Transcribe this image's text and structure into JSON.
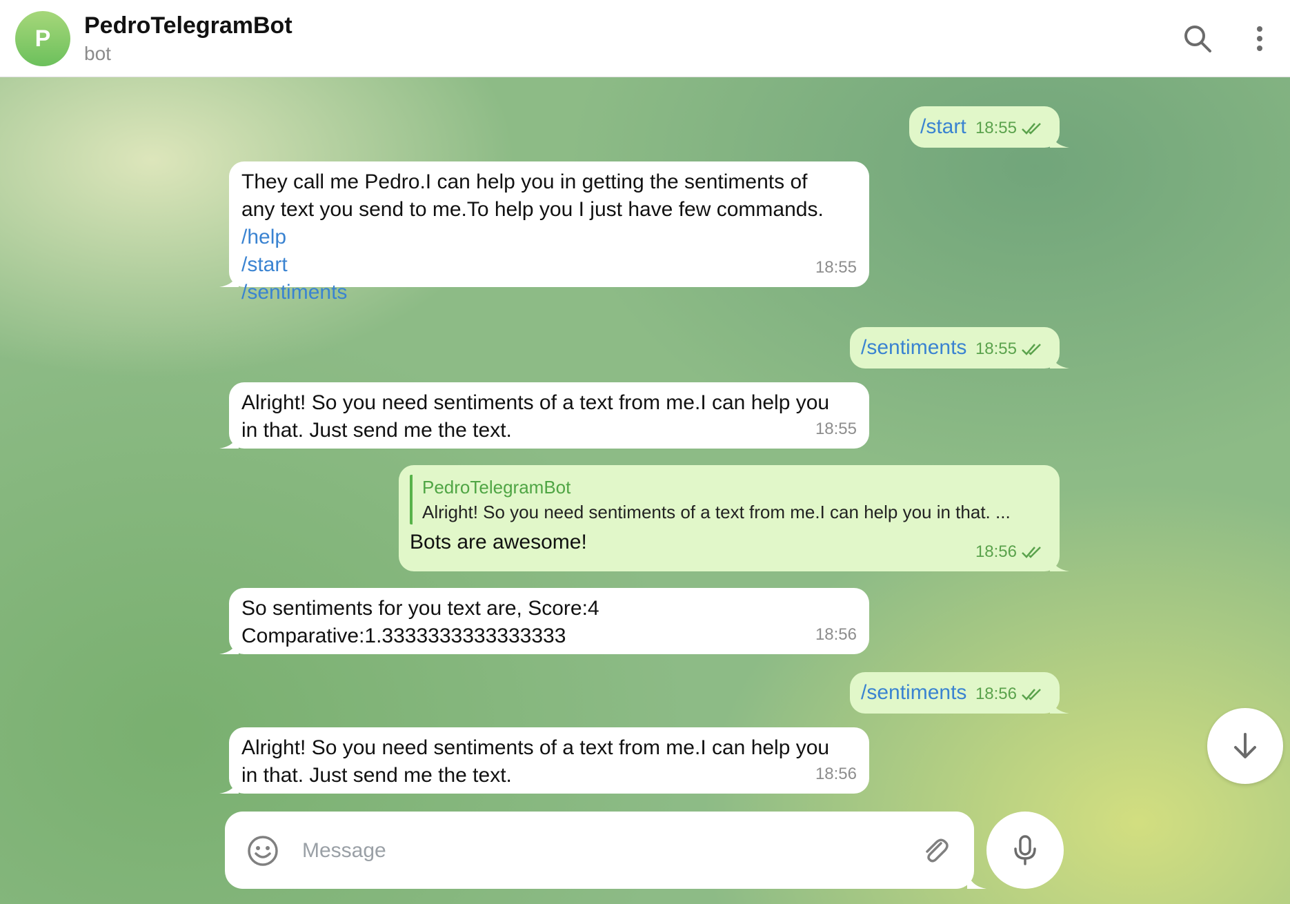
{
  "header": {
    "avatar_letter": "P",
    "title": "PedroTelegramBot",
    "subtitle": "bot"
  },
  "composer": {
    "placeholder": "Message"
  },
  "messages": [
    {
      "direction": "out",
      "text": "/start",
      "time": "18:55"
    },
    {
      "direction": "in",
      "text": "They call me Pedro.I can help you in getting the sentiments of any text you send to me.To help you I just have few commands.",
      "commands": [
        "/help",
        "/start",
        "/sentiments"
      ],
      "time": "18:55"
    },
    {
      "direction": "out",
      "text": "/sentiments",
      "time": "18:55"
    },
    {
      "direction": "in",
      "text": "Alright! So you need sentiments of a text from me.I can help you in that. Just send me the text.",
      "time": "18:55"
    },
    {
      "direction": "out",
      "reply_to": {
        "name": "PedroTelegramBot",
        "text": "Alright! So you need sentiments of a text from me.I can help you in that. ..."
      },
      "text": "Bots are awesome!",
      "time": "18:56"
    },
    {
      "direction": "in",
      "line1": "So sentiments for you text are, Score:4",
      "line2": "Comparative:1.3333333333333333",
      "time": "18:56"
    },
    {
      "direction": "out",
      "text": "/sentiments",
      "time": "18:56"
    },
    {
      "direction": "in",
      "text": "Alright! So you need sentiments of a text from me.I can help you in that. Just send me the text.",
      "time": "18:56"
    }
  ],
  "icons": {
    "search": "search-icon",
    "menu": "more-vertical-icon",
    "emoji": "emoji-icon",
    "attach": "paperclip-icon",
    "mic": "microphone-icon",
    "scroll": "arrow-down-icon",
    "read": "double-check-icon"
  },
  "colors": {
    "outgoing_bubble": "#e1f7c9",
    "incoming_bubble": "#ffffff",
    "link": "#3a83d1",
    "accent_green": "#5aa24c"
  }
}
